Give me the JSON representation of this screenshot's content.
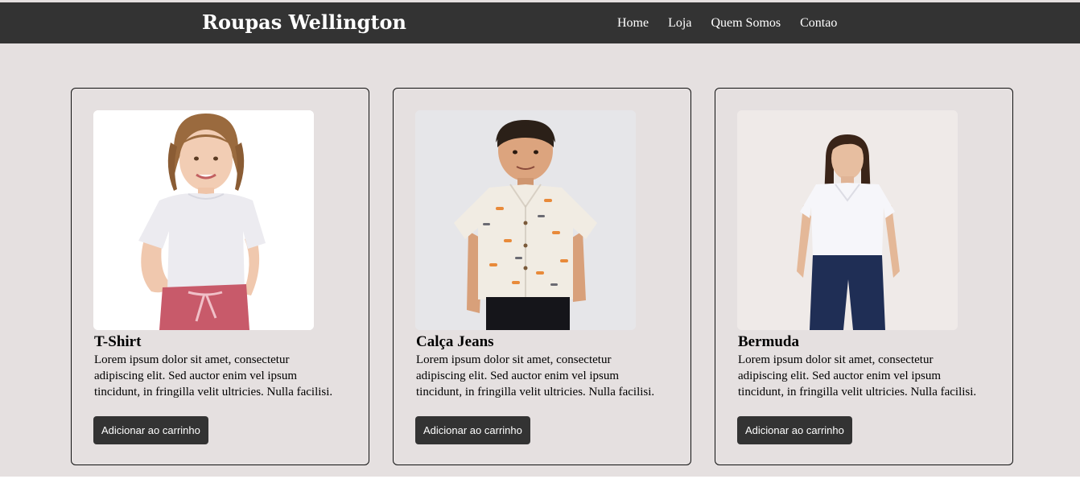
{
  "header": {
    "brand": "Roupas Wellington",
    "nav": [
      "Home",
      "Loja",
      "Quem Somos",
      "Contao"
    ]
  },
  "products": [
    {
      "title": "T-Shirt",
      "description": "Lorem ipsum dolor sit amet, consectetur adipiscing elit. Sed auctor enim vel ipsum tincidunt, in fringilla velit ultricies. Nulla facilisi.",
      "button": "Adicionar ao carrinho"
    },
    {
      "title": "Calça Jeans",
      "description": "Lorem ipsum dolor sit amet, consectetur adipiscing elit. Sed auctor enim vel ipsum tincidunt, in fringilla velit ultricies. Nulla facilisi.",
      "button": "Adicionar ao carrinho"
    },
    {
      "title": "Bermuda",
      "description": "Lorem ipsum dolor sit amet, consectetur adipiscing elit. Sed auctor enim vel ipsum tincidunt, in fringilla velit ultricies. Nulla facilisi.",
      "button": "Adicionar ao carrinho"
    }
  ],
  "colors": {
    "header_bg": "#333333",
    "page_bg": "#e5e0e0",
    "button_bg": "#333333",
    "text_light": "#ffffff"
  }
}
